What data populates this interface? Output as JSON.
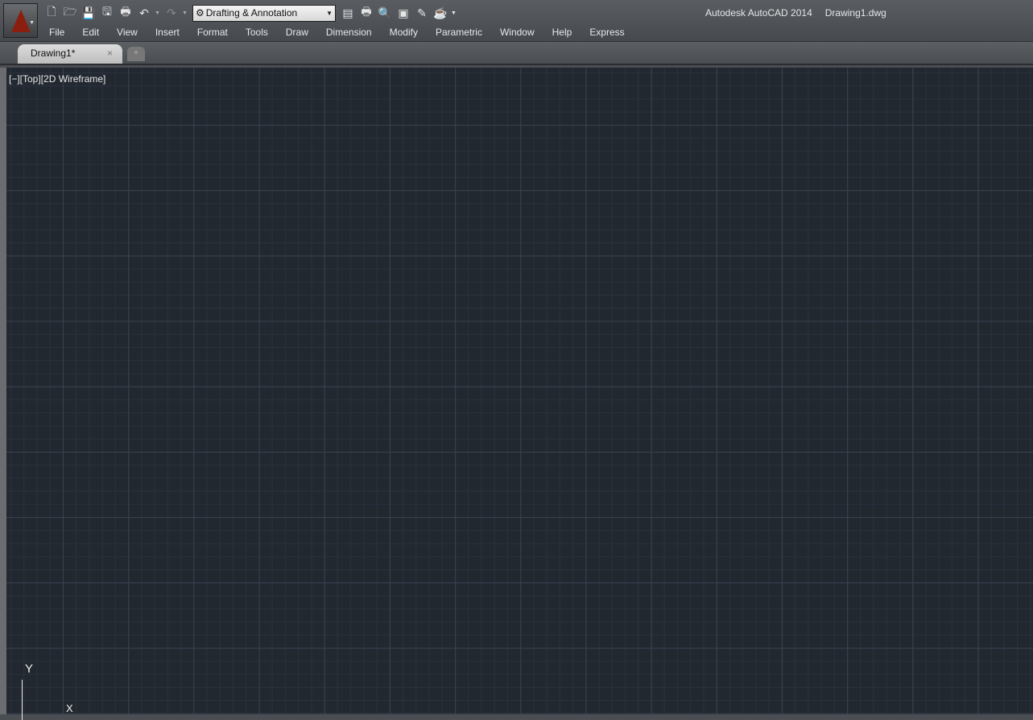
{
  "app": {
    "title": "Autodesk AutoCAD 2014",
    "document": "Drawing1.dwg"
  },
  "workspace": {
    "selected": "Drafting & Annotation"
  },
  "menu": [
    "File",
    "Edit",
    "View",
    "Insert",
    "Format",
    "Tools",
    "Draw",
    "Dimension",
    "Modify",
    "Parametric",
    "Window",
    "Help",
    "Express"
  ],
  "tabs": [
    {
      "label": "Drawing1*"
    }
  ],
  "viewport": {
    "label": "[−][Top][2D Wireframe]"
  },
  "ucs": {
    "y": "Y",
    "x": "X"
  }
}
